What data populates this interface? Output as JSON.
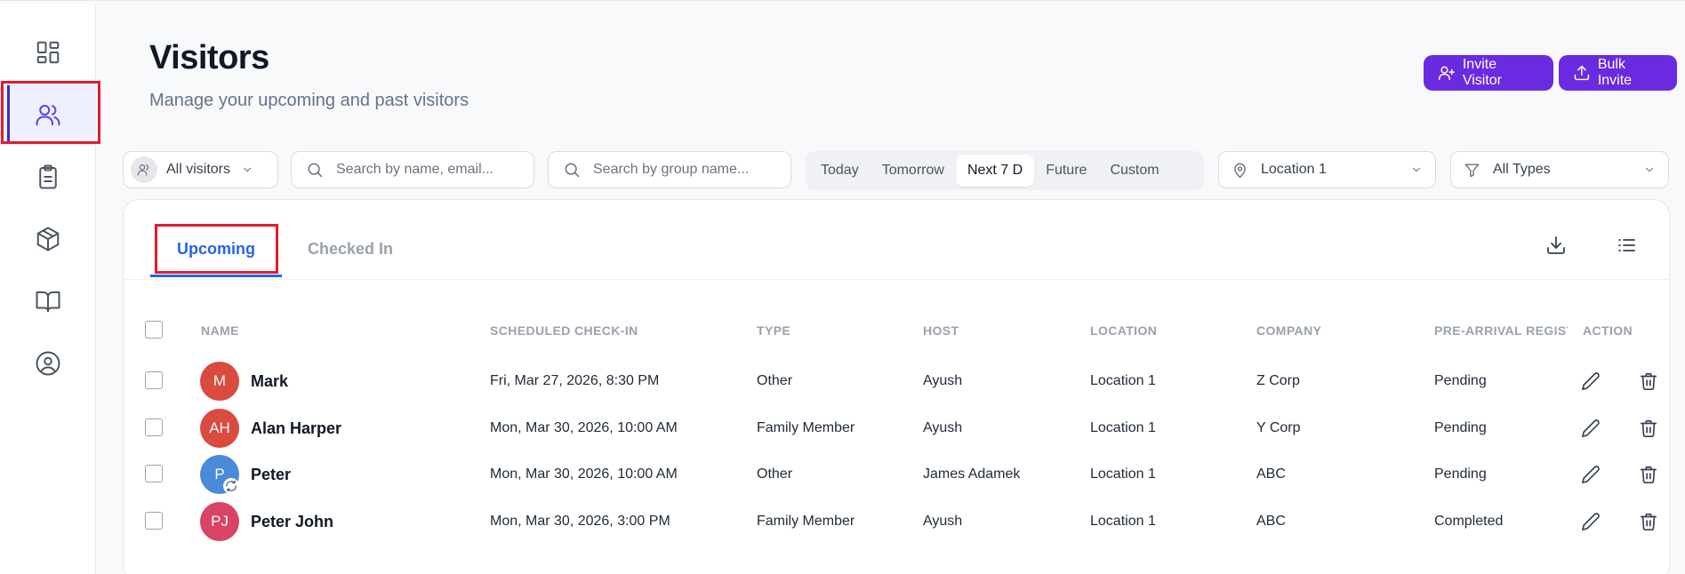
{
  "page": {
    "title": "Visitors",
    "subtitle": "Manage your upcoming and past visitors"
  },
  "sidebar": {
    "items": [
      {
        "icon": "dashboard-icon",
        "active": false
      },
      {
        "icon": "users-icon",
        "active": true
      },
      {
        "icon": "clipboard-icon",
        "active": false
      },
      {
        "icon": "package-icon",
        "active": false
      },
      {
        "icon": "book-icon",
        "active": false
      },
      {
        "icon": "user-circle-icon",
        "active": false
      }
    ]
  },
  "header_actions": {
    "invite": "Invite Visitor",
    "bulk": "Bulk Invite"
  },
  "filters": {
    "visitor_scope": "All visitors",
    "search_name_placeholder": "Search by name, email...",
    "search_group_placeholder": "Search by group name...",
    "date_ranges": [
      "Today",
      "Tomorrow",
      "Next 7 D",
      "Future",
      "Custom"
    ],
    "date_range_selected": "Next 7 D",
    "location": "Location 1",
    "type": "All Types"
  },
  "tabs": {
    "upcoming": "Upcoming",
    "checked_in": "Checked In",
    "active": "Upcoming"
  },
  "table": {
    "columns": [
      "NAME",
      "SCHEDULED CHECK-IN",
      "TYPE",
      "HOST",
      "LOCATION",
      "COMPANY",
      "PRE-ARRIVAL REGISTI",
      "ACTION"
    ],
    "rows": [
      {
        "initials": "M",
        "avatar_color": "#d84b3e",
        "name": "Mark",
        "checkin": "Fri, Mar 27, 2026, 8:30 PM",
        "type": "Other",
        "host": "Ayush",
        "location": "Location 1",
        "company": "Z Corp",
        "pre_arrival": "Pending"
      },
      {
        "initials": "AH",
        "avatar_color": "#d84b3e",
        "name": "Alan Harper",
        "checkin": "Mon, Mar 30, 2026, 10:00 AM",
        "type": "Family Member",
        "host": "Ayush",
        "location": "Location 1",
        "company": "Y Corp",
        "pre_arrival": "Pending"
      },
      {
        "initials": "P",
        "avatar_color": "#4a8ad8",
        "name": "Peter",
        "checkin": "Mon, Mar 30, 2026, 10:00 AM",
        "type": "Other",
        "host": "James Adamek",
        "location": "Location 1",
        "company": "ABC",
        "pre_arrival": "Pending",
        "recurring": true
      },
      {
        "initials": "PJ",
        "avatar_color": "#d84366",
        "name": "Peter John",
        "checkin": "Mon, Mar 30, 2026, 3:00 PM",
        "type": "Family Member",
        "host": "Ayush",
        "location": "Location 1",
        "company": "ABC",
        "pre_arrival": "Completed"
      }
    ]
  },
  "colors": {
    "accent": "#6a2be0",
    "tab_active": "#2563eb",
    "highlight": "#e11d2e"
  }
}
